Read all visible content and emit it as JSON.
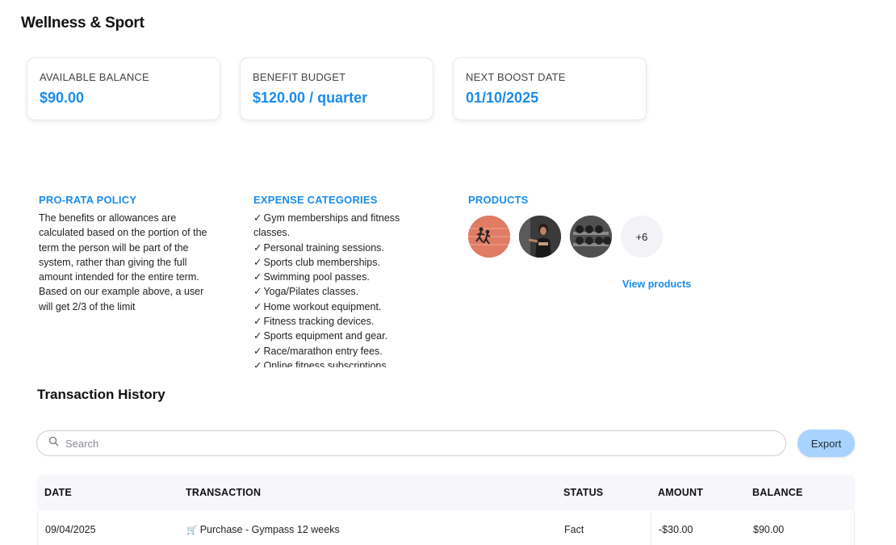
{
  "page": {
    "title": "Wellness & Sport"
  },
  "cards": [
    {
      "label": "AVAILABLE BALANCE",
      "value": "$90.00"
    },
    {
      "label": "BENEFIT BUDGET",
      "value": "$120.00 / quarter"
    },
    {
      "label": "NEXT BOOST DATE",
      "value": "01/10/2025"
    }
  ],
  "policy": {
    "title": "PRO-RATA POLICY",
    "text": "The benefits or allowances are calculated based on the portion of the term the person will be part of the system, rather than giving the full amount intended for the entire term. Based on our example above, a user will get 2/3 of the limit"
  },
  "categories": {
    "title": "EXPENSE CATEGORIES",
    "check": "✓",
    "items": [
      "Gym memberships and fitness classes.",
      "Personal training sessions.",
      "Sports club memberships.",
      "Swimming pool passes.",
      "Yoga/Pilates classes.",
      "Home workout equipment.",
      "Fitness tracking devices.",
      "Sports equipment and gear.",
      "Race/marathon entry fees.",
      "Online fitness subscriptions"
    ]
  },
  "products": {
    "title": "PRODUCTS",
    "more_count": "+6",
    "view_link": "View products"
  },
  "history": {
    "title": "Transaction History",
    "search_placeholder": "Search",
    "export_label": "Export",
    "columns": [
      "DATE",
      "TRANSACTION",
      "STATUS",
      "AMOUNT",
      "BALANCE"
    ],
    "rows": [
      {
        "date": "09/04/2025",
        "icon": "🛒",
        "transaction": "Purchase - Gympass 12 weeks",
        "status": "Fact",
        "amount": "-$30.00",
        "balance": "$90.00"
      }
    ]
  },
  "colors": {
    "accent": "#1a8cec",
    "export_button": "#a9d3ff",
    "table_header": "#f6f6fb"
  }
}
